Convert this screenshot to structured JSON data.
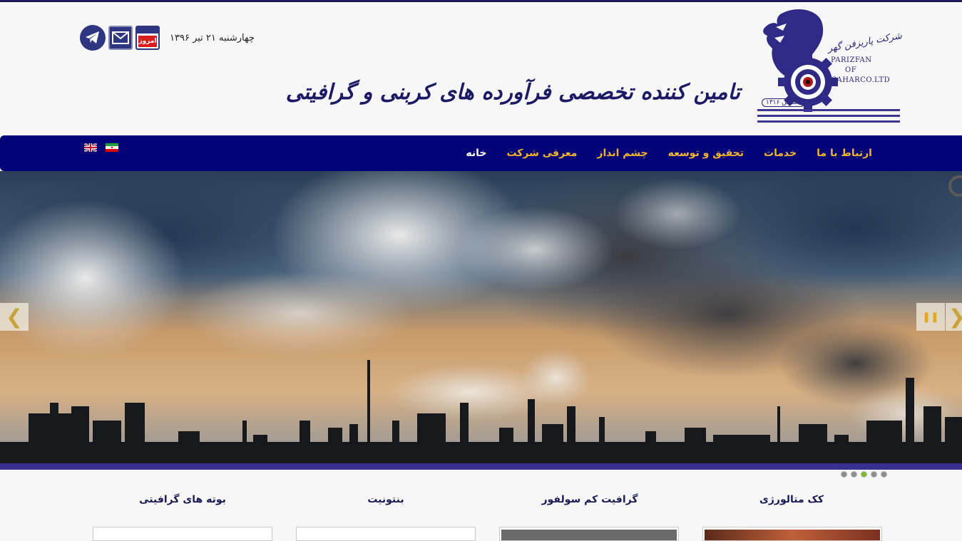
{
  "header": {
    "logo_fa": "شرکت پاریزفن گهر",
    "logo_en_lines": [
      "PARIZFAN",
      "OF",
      "GAHARCO.LTD"
    ],
    "logo_established": "تاسیس ۱۳۱۶",
    "tagline": "تامین کننده تخصصی فرآورده های کربنی و گرافیتی",
    "date": "چهارشنبه ۲۱ تیر ۱۳۹۶",
    "calendar_label": "امروز"
  },
  "nav": {
    "items": [
      "خانه",
      "معرفی شرکت",
      "چشم انداز",
      "تحقیق و توسعه",
      "خدمات",
      "ارتباط با ما"
    ]
  },
  "slider": {
    "dots": 5,
    "active_dot": 3
  },
  "products": [
    "کک متالورژی",
    "گرافیت کم سولفور",
    "بنتونیت",
    "بوته های گرافیتی"
  ],
  "colors": {
    "nav_bg": "#040277",
    "nav_text": "#f2b531",
    "brand": "#2b2577"
  }
}
